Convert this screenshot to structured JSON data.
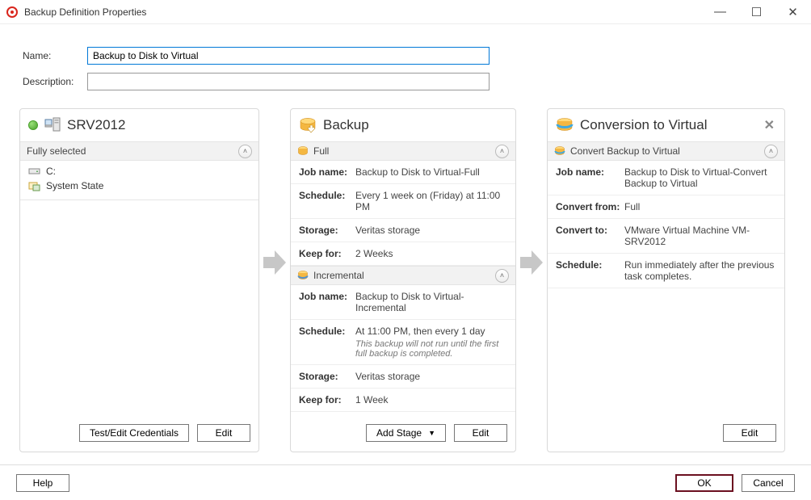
{
  "window": {
    "title": "Backup Definition Properties"
  },
  "form": {
    "name_label": "Name:",
    "name_value": "Backup to Disk to Virtual",
    "desc_label": "Description:",
    "desc_value": ""
  },
  "source": {
    "server": "SRV2012",
    "section": "Fully selected",
    "items": [
      {
        "icon": "drive",
        "label": "C:"
      },
      {
        "icon": "system",
        "label": "System State"
      }
    ],
    "btn_test": "Test/Edit Credentials",
    "btn_edit": "Edit"
  },
  "backup": {
    "title": "Backup",
    "full": {
      "header": "Full",
      "jobname_k": "Job name:",
      "jobname_v": "Backup to Disk to Virtual-Full",
      "schedule_k": "Schedule:",
      "schedule_v": "Every 1 week on (Friday) at 11:00 PM",
      "storage_k": "Storage:",
      "storage_v": "Veritas storage",
      "keep_k": "Keep for:",
      "keep_v": "2 Weeks"
    },
    "incr": {
      "header": "Incremental",
      "jobname_k": "Job name:",
      "jobname_v": "Backup to Disk to Virtual-Incremental",
      "schedule_k": "Schedule:",
      "schedule_v": "At 11:00 PM, then every 1 day",
      "schedule_note": "This backup will not run until the first full backup is completed.",
      "storage_k": "Storage:",
      "storage_v": "Veritas storage",
      "keep_k": "Keep for:",
      "keep_v": "1 Week"
    },
    "btn_addstage": "Add Stage",
    "btn_edit": "Edit"
  },
  "convert": {
    "title": "Conversion to Virtual",
    "header": "Convert Backup to Virtual",
    "jobname_k": "Job name:",
    "jobname_v": "Backup to Disk to Virtual-Convert Backup to Virtual",
    "from_k": "Convert from:",
    "from_v": "Full",
    "to_k": "Convert to:",
    "to_v": "VMware Virtual Machine VM-SRV2012",
    "schedule_k": "Schedule:",
    "schedule_v": "Run immediately after the previous task completes.",
    "btn_edit": "Edit"
  },
  "footer": {
    "help": "Help",
    "ok": "OK",
    "cancel": "Cancel"
  }
}
